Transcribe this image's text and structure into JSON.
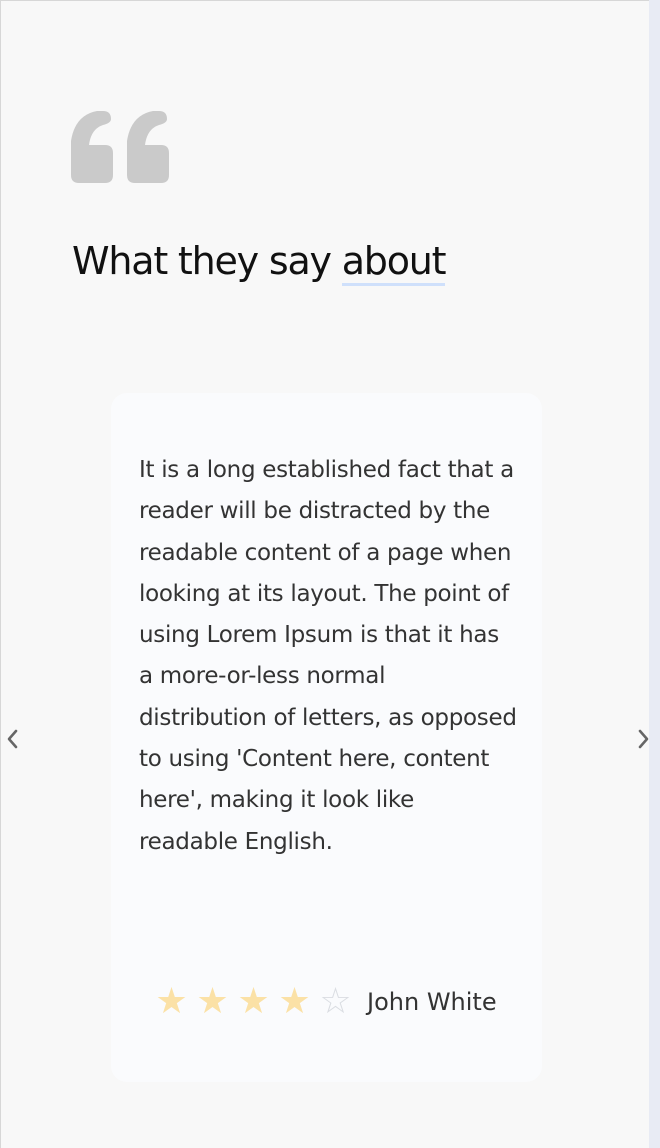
{
  "section": {
    "heading_main": "What they say",
    "heading_highlight": "about"
  },
  "icons": {
    "quote": "quote-marks-icon",
    "prev": "chevron-left-icon",
    "next": "chevron-right-icon",
    "star": "star-icon"
  },
  "colors": {
    "quote_icon": "#cacaca",
    "star_filled": "#fbe1a6",
    "star_empty": "#dadde2",
    "heading_underline": "#cfe0fb",
    "arrow": "#666666"
  },
  "testimonial": {
    "text": "It is a long established fact that a reader will be distracted by the readable content of a page when looking at its layout. The point of using Lorem Ipsum is that it has a more-or-less normal distribution of letters, as opposed to using 'Content here, content here', making it look like readable English.",
    "author": "John White",
    "rating": 4,
    "rating_max": 5
  }
}
